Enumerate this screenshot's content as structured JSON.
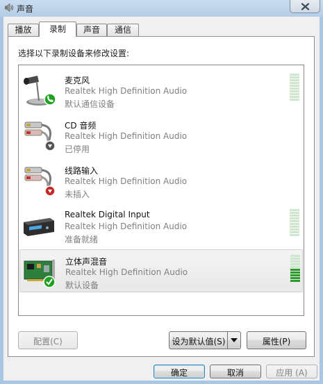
{
  "window": {
    "title": "声音",
    "close_glyph": "✕"
  },
  "tabs": [
    {
      "label": "播放",
      "active": false
    },
    {
      "label": "录制",
      "active": true
    },
    {
      "label": "声音",
      "active": false
    },
    {
      "label": "通信",
      "active": false
    }
  ],
  "panel": {
    "instruction": "选择以下录制设备来修改设置:"
  },
  "devices": [
    {
      "name": "麦克风",
      "description": "Realtek High Definition Audio",
      "status": "默认通信设备",
      "icon": "microphone-icon",
      "badge": "phone-badge",
      "meter_level": 0
    },
    {
      "name": "CD 音频",
      "description": "Realtek High Definition Audio",
      "status": "已停用",
      "icon": "rca-cable-icon",
      "badge": "disabled-badge"
    },
    {
      "name": "线路输入",
      "description": "Realtek High Definition Audio",
      "status": "未插入",
      "icon": "rca-cable-icon",
      "badge": "unplugged-badge"
    },
    {
      "name": "Realtek Digital Input",
      "description": "Realtek High Definition Audio",
      "status": "准备就绪",
      "icon": "digital-receiver-icon",
      "meter_level": 0
    },
    {
      "name": "立体声混音",
      "description": "Realtek High Definition Audio",
      "status": "默认设备",
      "icon": "sound-card-icon",
      "badge": "default-check-badge",
      "meter_level": 0.45,
      "selected": true
    }
  ],
  "buttons": {
    "configure": "配置(C)",
    "set_default": "设为默认值(S)",
    "properties": "属性(P)",
    "ok": "确定",
    "cancel": "取消",
    "apply": "应用 (A)"
  },
  "colors": {
    "meter_active": "#2e9a2e",
    "meter_inactive": "#cfe6cf",
    "selection": "#e9e9e9"
  }
}
